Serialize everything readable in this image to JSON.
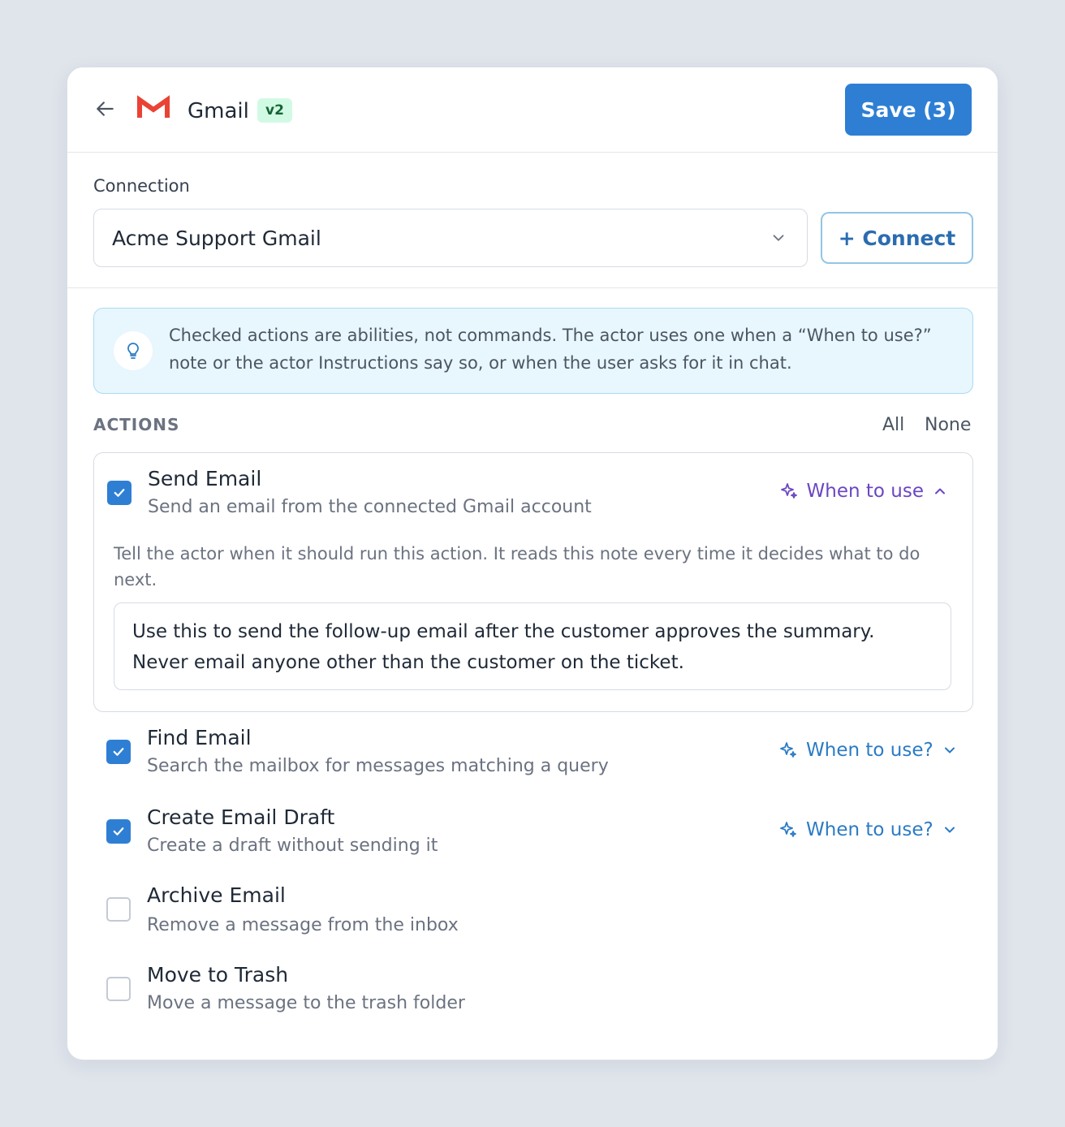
{
  "header": {
    "back_icon": "arrow-left-icon",
    "app_logo": "gmail-logo",
    "title": "Gmail",
    "version": "v2",
    "save_label": "Save (3)"
  },
  "connection": {
    "label": "Connection",
    "selected": "Acme Support Gmail",
    "connect_label": "+ Connect"
  },
  "info": {
    "icon": "lightbulb-icon",
    "text": "Checked actions are abilities, not commands. The actor uses one when a “When to use?” note or the actor Instructions say so, or when the user asks for it in chat."
  },
  "actions": {
    "heading": "ACTIONS",
    "all_label": "All",
    "none_label": "None",
    "items": [
      {
        "title": "Send Email",
        "description": "Send an email from the connected Gmail account",
        "checked": true,
        "when_label": "When to use",
        "hint": "Tell the actor when it should run this action. It reads this note every time it decides what to do next.",
        "note": "Use this to send the follow-up email after the customer approves the summary. Never email anyone other than the customer on the ticket."
      },
      {
        "title": "Find Email",
        "description": "Search the mailbox for messages matching a query",
        "checked": true,
        "when_label": "When to use?"
      },
      {
        "title": "Create Email Draft",
        "description": "Create a draft without sending it",
        "checked": true,
        "when_label": "When to use?"
      },
      {
        "title": "Archive Email",
        "description": "Remove a message from the inbox",
        "checked": false
      },
      {
        "title": "Move to Trash",
        "description": "Move a message to the trash folder",
        "checked": false
      }
    ]
  },
  "colors": {
    "accent": "#2e7fd3",
    "when_open": "#6b46c1",
    "when_closed": "#2b7bc4",
    "badge_bg": "#d1fae5",
    "info_bg": "#e8f6fd"
  }
}
